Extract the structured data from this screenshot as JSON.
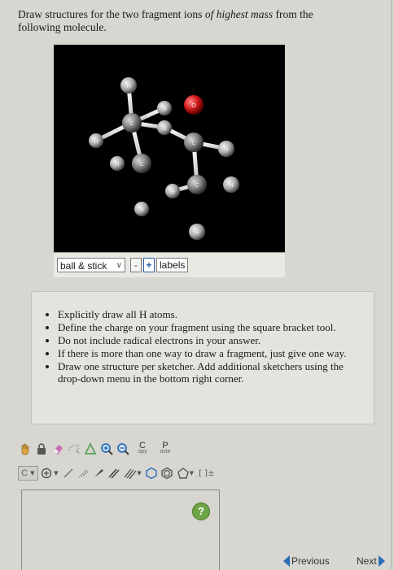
{
  "prompt": {
    "line1_a": "Draw structures for the two fragment ions ",
    "line1_em": "of highest mass",
    "line1_b": " from the",
    "line2": "following molecule."
  },
  "viewer": {
    "display_select": "ball & stick",
    "minus": "-",
    "plus": "+",
    "labels_button": "labels",
    "atoms": [
      "H",
      "H",
      "O",
      "H",
      "C",
      "H",
      "C",
      "H",
      "H",
      "C",
      "C",
      "H",
      "H",
      "H"
    ]
  },
  "instructions": [
    "Explicitly draw all H atoms.",
    "Define the charge on your fragment using the square bracket tool.",
    "Do not include radical electrons in your answer.",
    "If there is more than one way to draw a fragment, just give one way.",
    "Draw one structure per sketcher. Add additional sketchers using the drop-down menu in the bottom right corner."
  ],
  "sketcher": {
    "copy_big": "C",
    "copy_small": "opy",
    "paste_big": "P",
    "paste_small": "aste",
    "element_button": "C",
    "bracket_tool": "[ ]±"
  },
  "help_label": "?",
  "nav": {
    "previous": "Previous",
    "next": "Next"
  },
  "colors": {
    "nav_arrow": "#2c6db7",
    "help": "#6ea447",
    "oxygen": "#cc1f1f"
  }
}
